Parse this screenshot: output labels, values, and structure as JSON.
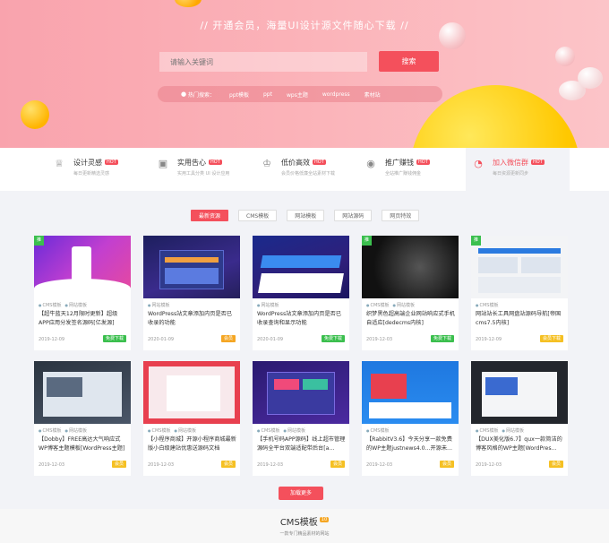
{
  "hero": {
    "title": "//  开通会员，海量UI设计源文件随心下载  //",
    "search_placeholder": "请输入关键词",
    "search_button": "搜索",
    "hot_label": "热门搜索：",
    "hot_terms": [
      "ppt模板",
      "ppt",
      "wps主题",
      "wordpress",
      "素材站"
    ]
  },
  "features": [
    {
      "title": "设计灵感",
      "badge": "HOT",
      "sub": "每日更新精选灵感",
      "icon": "trophy-icon"
    },
    {
      "title": "实用告心",
      "badge": "HOT",
      "sub": "实用工具分类 UI 设计应用",
      "icon": "image-icon"
    },
    {
      "title": "低价高效",
      "badge": "HOT",
      "sub": "会员价格低廉全站素材下载",
      "icon": "crown-icon"
    },
    {
      "title": "推广赚钱",
      "badge": "HOT",
      "sub": "全站推广赚钱佣金",
      "icon": "coin-icon"
    },
    {
      "title": "加入微信群",
      "badge": "HOT",
      "sub": "每日资源更新同步",
      "icon": "chat-icon"
    }
  ],
  "tabs": [
    "最新资源",
    "CMS模板",
    "网站模板",
    "网站源码",
    "网页特效"
  ],
  "cards": [
    {
      "tags": [
        "CMS模板",
        "网站模板"
      ],
      "title": "【超牛蓝天12月限时更新】超级APP应用分发签名源码[亿发源]",
      "date": "2019-12-09",
      "badge": "免费下载",
      "badge_color": "green",
      "corner": "推"
    },
    {
      "tags": [
        "网站模板"
      ],
      "title": "WordPress站文章添加内页是否已收录的功能",
      "date": "2020-01-09",
      "badge": "会员",
      "badge_color": "orange",
      "corner": ""
    },
    {
      "tags": [
        "网站模板"
      ],
      "title": "WordPress站文章添加内页是否已收录查询和显示功能",
      "date": "2020-01-09",
      "badge": "免费下载",
      "badge_color": "green",
      "corner": ""
    },
    {
      "tags": [
        "CMS模板",
        "网站模板"
      ],
      "title": "织梦黑色超高端企业网站响应式手机自适应[dedecms内核]",
      "date": "2019-12-03",
      "badge": "免费下载",
      "badge_color": "green",
      "corner": "推"
    },
    {
      "tags": [
        "CMS模板"
      ],
      "title": "网站站长工具网盘站源码导航[帝国cms7.5内核]",
      "date": "2019-12-09",
      "badge": "会员下载",
      "badge_color": "yellow",
      "corner": "推"
    },
    {
      "tags": [
        "CMS模板",
        "网站模板"
      ],
      "title": "【Dobby】FREE高达大气响应式WP博客主题模板[WordPress主题]",
      "date": "2019-12-03",
      "badge": "会员",
      "badge_color": "yellow",
      "corner": ""
    },
    {
      "tags": [
        "CMS模板",
        "网站模板"
      ],
      "title": "【小程序商城】开源小程序商城最新版小白级建站优惠送源码文档[Thin...",
      "date": "2019-12-03",
      "badge": "会员",
      "badge_color": "yellow",
      "corner": ""
    },
    {
      "tags": [
        "CMS模板",
        "网站模板"
      ],
      "title": "【手机号码APP源码】线上超市管理源码全平台双端适配带后台[a...",
      "date": "2019-12-03",
      "badge": "会员",
      "badge_color": "yellow",
      "corner": ""
    },
    {
      "tags": [
        "CMS模板"
      ],
      "title": "【RabbitV3.6】今天分享一款免费的WP主题justnews4.0...开源未...",
      "date": "2019-12-03",
      "badge": "会员",
      "badge_color": "yellow",
      "corner": ""
    },
    {
      "tags": [
        "CMS模板",
        "网站模板"
      ],
      "title": "【DUX美化版6.7】qux一款简洁的博客风格的WP主题[WordPres...",
      "date": "2019-12-03",
      "badge": "会员",
      "badge_color": "yellow",
      "corner": ""
    }
  ],
  "load_more": "加载更多",
  "section": {
    "title": "CMS模板",
    "badge": "10",
    "subtitle": "一款专门精品素材的网站"
  },
  "colors": {
    "accent": "#f4505c",
    "hero_pink": "#fbb3b9"
  }
}
